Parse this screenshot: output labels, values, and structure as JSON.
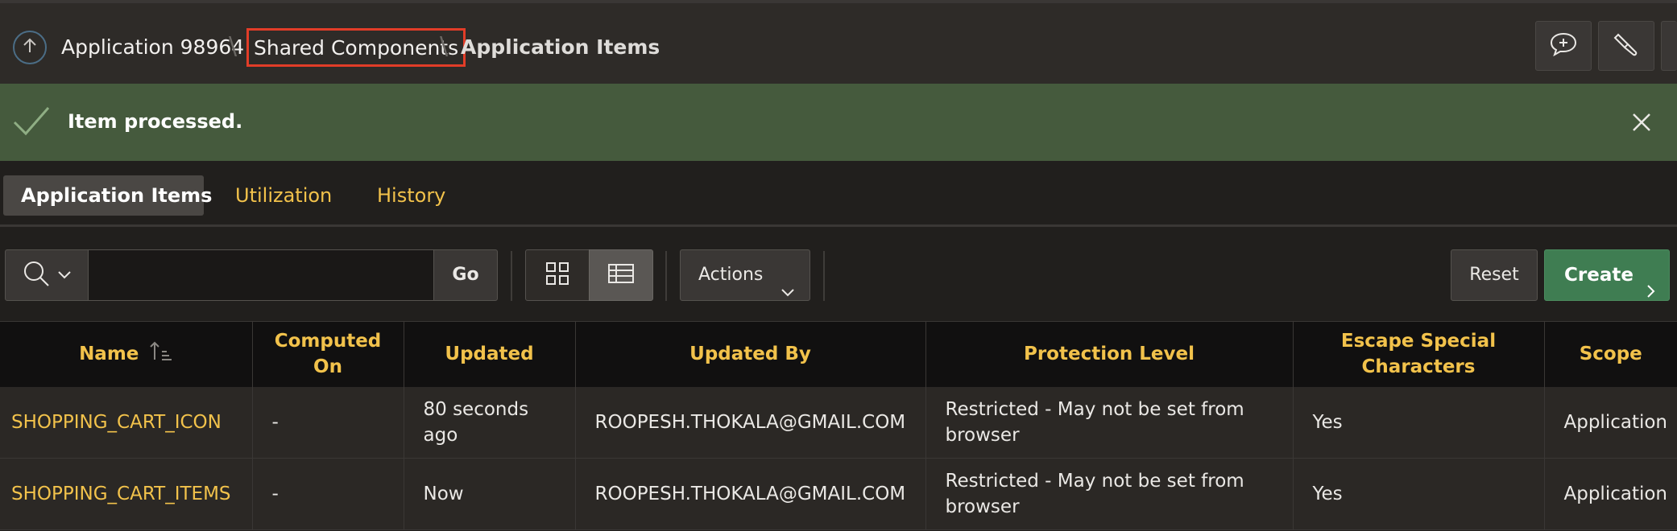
{
  "breadcrumb": {
    "app": "Application 98964",
    "shared": "Shared Components",
    "current": "Application Items",
    "separator": "\\"
  },
  "alert": {
    "message": "Item processed."
  },
  "tabs": [
    {
      "label": "Application Items"
    },
    {
      "label": "Utilization"
    },
    {
      "label": "History"
    }
  ],
  "toolbar": {
    "search_value": "",
    "go_label": "Go",
    "actions_label": "Actions",
    "reset_label": "Reset",
    "create_label": "Create"
  },
  "table": {
    "columns": [
      "Name",
      "Computed On",
      "Updated",
      "Updated By",
      "Protection Level",
      "Escape Special Characters",
      "Scope"
    ],
    "rows": [
      [
        "SHOPPING_CART_ICON",
        "-",
        "80 seconds ago",
        "ROOPESH.THOKALA@GMAIL.COM",
        "Restricted - May not be set from browser",
        "Yes",
        "Application"
      ],
      [
        "SHOPPING_CART_ITEMS",
        "-",
        "Now",
        "ROOPESH.THOKALA@GMAIL.COM",
        "Restricted - May not be set from browser",
        "Yes",
        "Application"
      ]
    ]
  },
  "colors": {
    "accent": "#f2c24b",
    "success": "#455a3d",
    "create": "#3f7d52",
    "highlight": "#e23d28"
  },
  "icons": [
    "up-arrow-icon",
    "comment-icon",
    "brush-icon",
    "checkmark-icon",
    "close-icon",
    "search-icon",
    "chevron-down-icon",
    "grid-view-icon",
    "table-view-icon",
    "chevron-right-icon",
    "sort-ascending-icon"
  ]
}
